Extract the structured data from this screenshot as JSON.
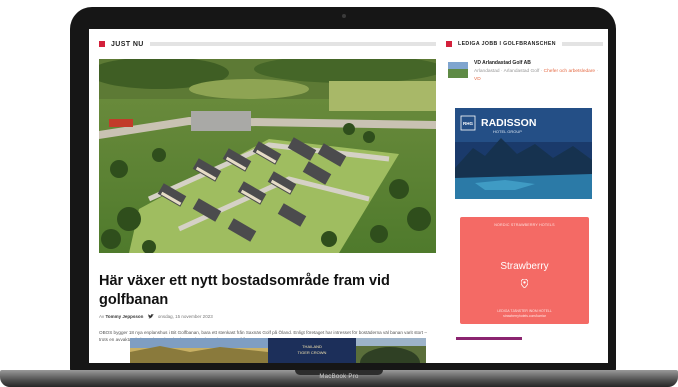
{
  "device": {
    "brand_label": "MacBook Pro"
  },
  "main": {
    "section_title": "JUST NU",
    "article": {
      "headline": "Här växer ett nytt bostadsområde fram vid golfbanan",
      "byline_prefix": "Av",
      "author": "Tommy Jeppsson",
      "date": "onsdag, 15 november 2023",
      "excerpt": "OBOS bygger 18 nya enplanshus i Bit Golfbanan, bara ett stenkast från Saxnäs Golf på Öland. Enligt företaget har intresset för bostäderna väl banan varit stort – trots en avvaktande bostadsmarknad. Planerat har det varit personer från"
    },
    "strip_ad_text": [
      "THAILAND",
      "TIGER CROWN"
    ]
  },
  "sidebar": {
    "section_title": "LEDIGA JOBB I GOLFBRANSCHEN",
    "job": {
      "title": "VD Arlandastad Golf AB",
      "company": "Arlandastad",
      "location": "Arlandastad Golf",
      "category": "Chefer och arbetsledare",
      "role": "VD"
    },
    "ad_radisson": {
      "logo_mark": "RHG",
      "name": "RADISSON",
      "subtitle": "HOTEL GROUP"
    },
    "ad_strawberry": {
      "top_text": "NORDIC STRAWBERRY HOTELS",
      "name": "Strawberry",
      "bottom_text": [
        "LEDIGA TJÄNSTER INOM HOTELL",
        "strawberryhotels.com/karriar"
      ]
    }
  },
  "colors": {
    "accent_red": "#d3203b",
    "link_orange": "#e56b45",
    "strawberry": "#f46a65",
    "radisson_blue": "#1a3a6b"
  },
  "icons": [
    "twitter-icon",
    "map-pin-icon"
  ]
}
